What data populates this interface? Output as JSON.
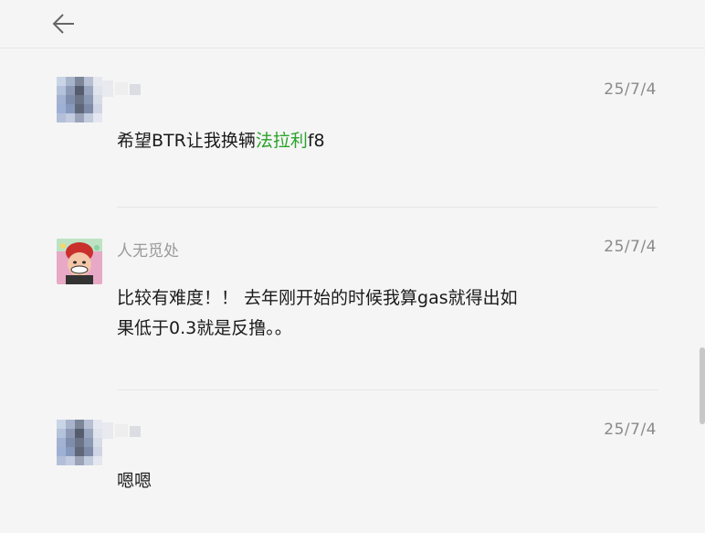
{
  "messages": [
    {
      "username": "",
      "date": "25/7/4",
      "text_parts": [
        "希望BTR让我换辆",
        "法拉利",
        "f8"
      ]
    },
    {
      "username": "人无觅处",
      "date": "25/7/4",
      "lines": [
        "比较有难度！！ 去年刚开始的时候我算gas就得出如",
        "果低于0.3就是反撸。。"
      ]
    },
    {
      "username": "",
      "date": "25/7/4",
      "text": "嗯嗯"
    }
  ],
  "colors": {
    "background": "#f5f5f5",
    "link_green": "#2aa32a",
    "meta_gray": "#8a8a8a"
  },
  "icons": {
    "back": "arrow-left-icon"
  }
}
